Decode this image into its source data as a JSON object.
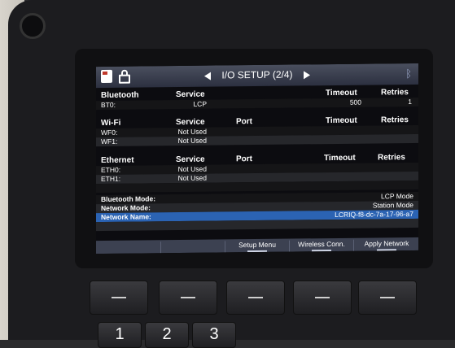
{
  "header": {
    "title": "I/O SETUP (2/4)"
  },
  "icons": {
    "sd": "sd-card-icon",
    "lock": "lock-icon",
    "bluetooth": "bluetooth-icon"
  },
  "bluetooth": {
    "heading": "Bluetooth",
    "col_service": "Service",
    "col_timeout": "Timeout",
    "col_retries": "Retries",
    "rows": [
      {
        "name": "BT0:",
        "service": "LCP",
        "timeout": "500",
        "retries": "1"
      }
    ]
  },
  "wifi": {
    "heading": "Wi-Fi",
    "col_service": "Service",
    "col_port": "Port",
    "col_timeout": "Timeout",
    "col_retries": "Retries",
    "rows": [
      {
        "name": "WF0:",
        "service": "Not Used"
      },
      {
        "name": "WF1:",
        "service": "Not Used"
      }
    ]
  },
  "ethernet": {
    "heading": "Ethernet",
    "col_service": "Service",
    "col_port": "Port",
    "col_timeout": "Timeout",
    "col_retries": "Retries",
    "rows": [
      {
        "name": "ETH0:",
        "service": "Not Used"
      },
      {
        "name": "ETH1:",
        "service": "Not Used"
      }
    ]
  },
  "settings": [
    {
      "label": "Bluetooth Mode:",
      "value": "LCP Mode"
    },
    {
      "label": "Network Mode:",
      "value": "Station Mode"
    },
    {
      "label": "Network Name:",
      "value": "LCRIQ-f8-dc-7a-17-96-a7"
    }
  ],
  "softkeys": [
    "",
    "",
    "Setup Menu",
    "Wireless Conn.",
    "Apply Network"
  ],
  "keypad": [
    "1",
    "2",
    "3"
  ],
  "colors": {
    "selected_row": "#2b63b3",
    "header_bar": "#3c4151"
  }
}
